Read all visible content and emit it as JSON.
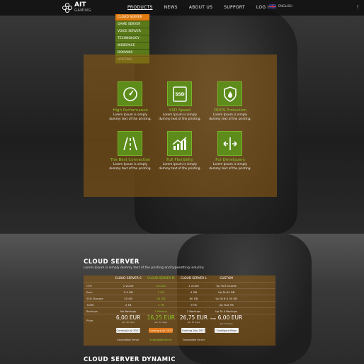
{
  "brand": {
    "name": "AIT",
    "tagline": "GAMING"
  },
  "nav": {
    "items": [
      {
        "label": "PRODUCTS",
        "active": true
      },
      {
        "label": "NEWS"
      },
      {
        "label": "ABOUT US"
      },
      {
        "label": "SUPPORT"
      },
      {
        "label": "LOG IN"
      }
    ],
    "language": "ENGLISH",
    "social_icon": "f"
  },
  "products_menu": [
    "CLOUD SERVER",
    "GAME SERVER",
    "VOICE SERVER",
    "TECHNOLOGY",
    "WEBSPACE",
    "DOMAINS",
    "HOSTING"
  ],
  "features": [
    {
      "icon": "gauge-icon",
      "title": "High Performance",
      "desc1": "Lorem Ipsum is simply",
      "desc2": "dummy text of the printing."
    },
    {
      "icon": "ssd-icon",
      "title": "SSD Speed",
      "desc1": "Lorem Ipsum is simply",
      "desc2": "dummy text of the printing."
    },
    {
      "icon": "shield-fire-icon",
      "title": "DDOS Protection",
      "desc1": "Lorem Ipsum is simply",
      "desc2": "dummy text of the printing."
    },
    {
      "icon": "road-icon",
      "title": "The Best Connection",
      "desc1": "Lorem Ipsum is simply",
      "desc2": "dummy text of the printing."
    },
    {
      "icon": "growth-chart-icon",
      "title": "Full Flexibility",
      "desc1": "Lorem Ipsum is simply",
      "desc2": "dummy text of the printing."
    },
    {
      "icon": "arrows-icon",
      "title": "For Developers",
      "desc1": "Lorem Ipsum is simply",
      "desc2": "dummy text of the printing."
    }
  ],
  "ssd_label": "SSD",
  "cloud_server": {
    "title": "CLOUD SERVER",
    "subtitle": "Lorem Ipsum is simply dummy text of the printing and typesetting industry.",
    "columns": [
      "CLOUD SERVER S",
      "CLOUD SERVER M",
      "CLOUD SERVER L",
      "CUSTOM"
    ],
    "rows": [
      {
        "label": "CPU",
        "values": [
          "1 vCore",
          "2vCore",
          "1 vCore",
          "Up To 8 vCores"
        ]
      },
      {
        "label": "Ram",
        "values": [
          "2-3 GB",
          "2 GB",
          "4 GB",
          "Up To 64 GB"
        ]
      },
      {
        "label": "SSD Storage",
        "values": [
          "20 GB",
          "40 GB",
          "80 GB",
          "Up To 8 0 00 GB"
        ]
      },
      {
        "label": "Traffic",
        "values": [
          "2 TB",
          "3 TB",
          "3 TB",
          "Up To 8 TB"
        ]
      },
      {
        "label": "Backups",
        "values": [
          "No Backups",
          "1 Backup",
          "2 Backups",
          "Up To 4 Backups"
        ]
      },
      {
        "label": "Price",
        "values": [
          "",
          "",
          "",
          ""
        ]
      }
    ],
    "prices": [
      {
        "value": "6,00 EUR",
        "per": "per 30 days"
      },
      {
        "value": "16,25 EUR",
        "per": "per 30 days"
      },
      {
        "value": "26,75 EUR",
        "per": "per 30 days"
      },
      {
        "value": "6,00 EUR",
        "per": "per 30 days",
        "prefix": "from"
      }
    ],
    "buttons": [
      "Coming July 2017",
      "Coming July 2017",
      "Coming July 2017",
      "Configure Now"
    ],
    "links": [
      "Expandable Server",
      "Expandable Server",
      "Expandable Server",
      ""
    ]
  },
  "cloud_server_dynamic": {
    "title": "CLOUD SERVER DYNAMIC"
  },
  "colors": {
    "accent_green": "#8ccf2a",
    "accent_orange": "#e07b10",
    "panel": "#96601a"
  }
}
